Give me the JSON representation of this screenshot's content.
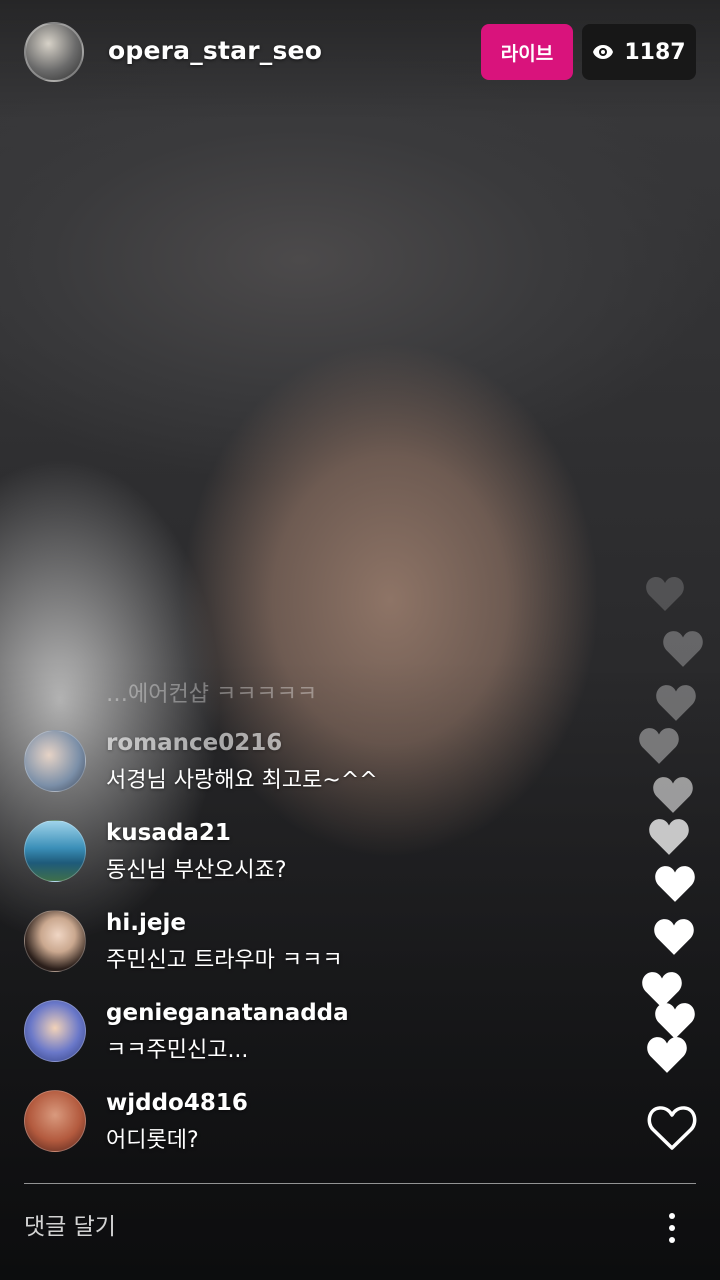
{
  "header": {
    "host_username": "opera_star_seo",
    "live_label": "라이브",
    "viewer_count": "1187",
    "viewer_icon": "eye-icon"
  },
  "comments": {
    "faded": {
      "message": "…에어컨샵 ㅋㅋㅋㅋㅋ"
    },
    "items": [
      {
        "username": "romance0216",
        "message": "서경님 사랑해요 최고로~^^",
        "avatar_color": "#7b8fa8"
      },
      {
        "username": "kusada21",
        "message": "동신님 부산오시죠?",
        "avatar_color": "#3b8fb8"
      },
      {
        "username": "hi.jeje",
        "message": "주민신고 트라우마 ㅋㅋㅋ",
        "avatar_color": "#caa88f"
      },
      {
        "username": "genieganatanadda",
        "message": "ㅋㅋ주민신고...",
        "avatar_color": "#6a78c9"
      },
      {
        "username": "wjddo4816",
        "message": "어디롯데?",
        "avatar_color": "#b35a3e"
      }
    ]
  },
  "footer": {
    "comment_placeholder": "댓글 달기",
    "more_icon": "more-vertical-icon",
    "like_icon": "heart-outline-icon"
  },
  "colors": {
    "live_badge": "#d9137c",
    "viewer_badge": "#141414"
  }
}
